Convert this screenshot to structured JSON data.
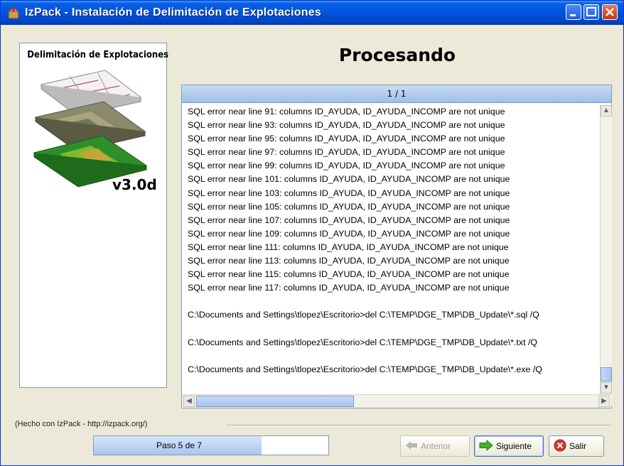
{
  "window": {
    "title": "IzPack - Instalación de Delimitación de Explotaciones",
    "colors": {
      "titlebar": "#0054e3",
      "body": "#ece9d8",
      "accent": "#a8c6ee"
    }
  },
  "sidebar": {
    "title": "Delimitación de Explotaciones",
    "version": "v3.0d",
    "image_icon": "layered-terrain-map-image"
  },
  "main": {
    "heading": "Procesando",
    "panel_header": "1 / 1",
    "log_lines": [
      "SQL error near line 91: columns ID_AYUDA, ID_AYUDA_INCOMP are not unique",
      "SQL error near line 93: columns ID_AYUDA, ID_AYUDA_INCOMP are not unique",
      "SQL error near line 95: columns ID_AYUDA, ID_AYUDA_INCOMP are not unique",
      "SQL error near line 97: columns ID_AYUDA, ID_AYUDA_INCOMP are not unique",
      "SQL error near line 99: columns ID_AYUDA, ID_AYUDA_INCOMP are not unique",
      "SQL error near line 101: columns ID_AYUDA, ID_AYUDA_INCOMP are not unique",
      "SQL error near line 103: columns ID_AYUDA, ID_AYUDA_INCOMP are not unique",
      "SQL error near line 105: columns ID_AYUDA, ID_AYUDA_INCOMP are not unique",
      "SQL error near line 107: columns ID_AYUDA, ID_AYUDA_INCOMP are not unique",
      "SQL error near line 109: columns ID_AYUDA, ID_AYUDA_INCOMP are not unique",
      "SQL error near line 111: columns ID_AYUDA, ID_AYUDA_INCOMP are not unique",
      "SQL error near line 113: columns ID_AYUDA, ID_AYUDA_INCOMP are not unique",
      "SQL error near line 115: columns ID_AYUDA, ID_AYUDA_INCOMP are not unique",
      "SQL error near line 117: columns ID_AYUDA, ID_AYUDA_INCOMP are not unique",
      "",
      "C:\\Documents and Settings\\tlopez\\Escritorio>del C:\\TEMP\\DGE_TMP\\DB_Update\\*.sql /Q",
      "",
      "C:\\Documents and Settings\\tlopez\\Escritorio>del C:\\TEMP\\DGE_TMP\\DB_Update\\*.txt /Q",
      "",
      "C:\\Documents and Settings\\tlopez\\Escritorio>del C:\\TEMP\\DGE_TMP\\DB_Update\\*.exe /Q",
      ""
    ]
  },
  "footer": {
    "credit": "(Hecho con IzPack - http://izpack.org/)",
    "progress_text": "Paso 5 de 7",
    "progress_fraction": 0.714,
    "buttons": {
      "previous": "Anterior",
      "next": "Siguiente",
      "exit": "Salir"
    }
  }
}
